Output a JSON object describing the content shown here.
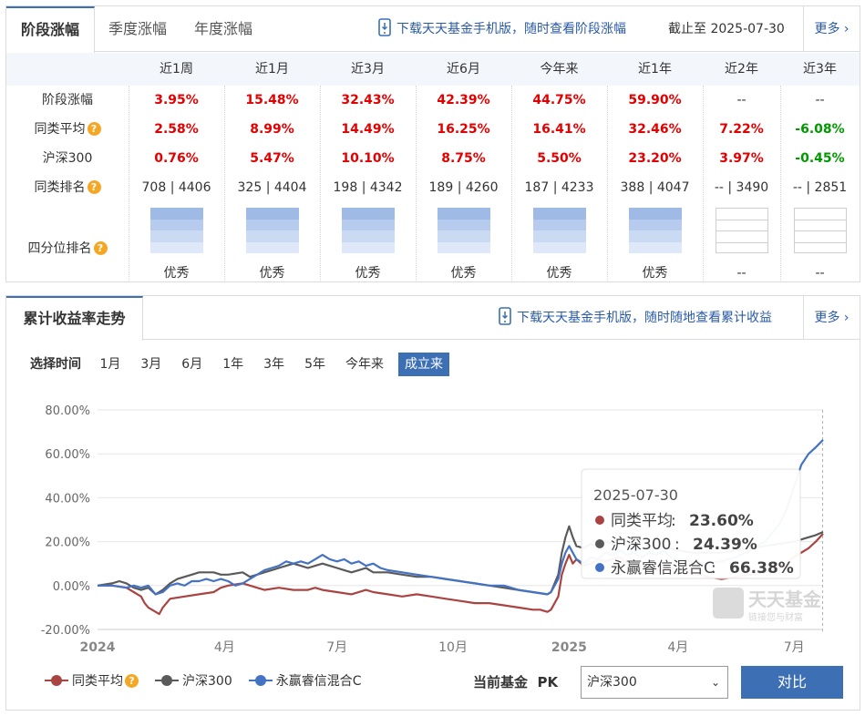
{
  "panel1": {
    "tabs": [
      "阶段涨幅",
      "季度涨幅",
      "年度涨幅"
    ],
    "promo": "下载天天基金手机版，随时查看阶段涨幅",
    "as_of_label": "截止至",
    "as_of_date": "2025-07-30",
    "more": "更多",
    "columns": [
      "近1周",
      "近1月",
      "近3月",
      "近6月",
      "今年来",
      "近1年",
      "近2年",
      "近3年"
    ],
    "rows": [
      {
        "label": "阶段涨幅",
        "has_help": false,
        "values": [
          "3.95%",
          "15.48%",
          "32.43%",
          "42.39%",
          "44.75%",
          "59.90%",
          "--",
          "--"
        ]
      },
      {
        "label": "同类平均",
        "has_help": true,
        "values": [
          "2.58%",
          "8.99%",
          "14.49%",
          "16.25%",
          "16.41%",
          "32.46%",
          "7.22%",
          "-6.08%"
        ]
      },
      {
        "label": "沪深300",
        "has_help": false,
        "values": [
          "0.76%",
          "5.47%",
          "10.10%",
          "8.75%",
          "5.50%",
          "23.20%",
          "3.97%",
          "-0.45%"
        ]
      },
      {
        "label": "同类排名",
        "has_help": true,
        "values": [
          "708 | 4406",
          "325 | 4404",
          "198 | 4342",
          "189 | 4260",
          "187 | 4233",
          "388 | 4047",
          "-- | 3490",
          "-- | 2851"
        ]
      }
    ],
    "quartile_label": "四分位排名",
    "quartile": [
      {
        "level": 4,
        "text": "优秀"
      },
      {
        "level": 4,
        "text": "优秀"
      },
      {
        "level": 4,
        "text": "优秀"
      },
      {
        "level": 4,
        "text": "优秀"
      },
      {
        "level": 4,
        "text": "优秀"
      },
      {
        "level": 4,
        "text": "优秀"
      },
      {
        "level": 0,
        "text": "--"
      },
      {
        "level": 0,
        "text": "--"
      }
    ],
    "colors": {
      "up": "#e30000",
      "down": "#009900",
      "accent": "#3d6fb5"
    }
  },
  "panel2": {
    "title": "累计收益率走势",
    "promo": "下载天天基金手机版，随时随地查看累计收益",
    "more": "更多",
    "range_label": "选择时间",
    "ranges": [
      "1月",
      "3月",
      "6月",
      "1年",
      "3年",
      "5年",
      "今年来",
      "成立来"
    ],
    "active_range": "成立来",
    "pk_label": "当前基金",
    "pk_word": "PK",
    "select_value": "沪深300",
    "compare_button": "对比",
    "tooltip": {
      "date": "2025-07-30",
      "items": [
        {
          "name": "同类平均",
          "value": "23.60%"
        },
        {
          "name": "沪深300",
          "value": "24.39%"
        },
        {
          "name": "永赢睿信混合C",
          "value": "66.38%"
        }
      ]
    },
    "watermark": {
      "main": "天天基金",
      "sub": "链接您与财富"
    }
  },
  "chart_data": {
    "type": "line",
    "ylim": [
      -20,
      80
    ],
    "y_ticks": [
      "80.00%",
      "60.00%",
      "40.00%",
      "20.00%",
      "0.00%",
      "-20.00%"
    ],
    "x_tick_labels": [
      "2024",
      "4月",
      "7月",
      "10月",
      "2025",
      "4月",
      "7月"
    ],
    "x_tick_bold": [
      true,
      false,
      false,
      false,
      true,
      false,
      false
    ],
    "legend": [
      "同类平均",
      "沪深300",
      "永赢睿信混合C"
    ],
    "series": [
      {
        "name": "同类平均",
        "color": "#a94442",
        "points": [
          [
            0,
            0
          ],
          [
            0.02,
            0
          ],
          [
            0.04,
            -1
          ],
          [
            0.05,
            -3
          ],
          [
            0.06,
            -5
          ],
          [
            0.065,
            -8
          ],
          [
            0.07,
            -10
          ],
          [
            0.08,
            -12
          ],
          [
            0.085,
            -13
          ],
          [
            0.09,
            -10
          ],
          [
            0.1,
            -6
          ],
          [
            0.12,
            -5
          ],
          [
            0.14,
            -4
          ],
          [
            0.16,
            -3
          ],
          [
            0.17,
            -1
          ],
          [
            0.18,
            0
          ],
          [
            0.2,
            1
          ],
          [
            0.21,
            0
          ],
          [
            0.22,
            -1
          ],
          [
            0.23,
            -2
          ],
          [
            0.25,
            -1
          ],
          [
            0.27,
            -2
          ],
          [
            0.29,
            -2
          ],
          [
            0.3,
            -1
          ],
          [
            0.31,
            -2
          ],
          [
            0.33,
            -3
          ],
          [
            0.35,
            -4
          ],
          [
            0.37,
            -2
          ],
          [
            0.38,
            -3
          ],
          [
            0.4,
            -4
          ],
          [
            0.42,
            -5
          ],
          [
            0.44,
            -4
          ],
          [
            0.46,
            -5
          ],
          [
            0.48,
            -6
          ],
          [
            0.5,
            -7
          ],
          [
            0.52,
            -8
          ],
          [
            0.54,
            -8
          ],
          [
            0.56,
            -9
          ],
          [
            0.58,
            -10
          ],
          [
            0.6,
            -11
          ],
          [
            0.61,
            -11
          ],
          [
            0.62,
            -12
          ],
          [
            0.625,
            -11
          ],
          [
            0.635,
            -5
          ],
          [
            0.64,
            5
          ],
          [
            0.645,
            10
          ],
          [
            0.65,
            14
          ],
          [
            0.655,
            10
          ],
          [
            0.66,
            12
          ],
          [
            0.67,
            9
          ],
          [
            0.68,
            10
          ],
          [
            0.69,
            12
          ],
          [
            0.7,
            11
          ],
          [
            0.72,
            13
          ],
          [
            0.73,
            10
          ],
          [
            0.74,
            8
          ],
          [
            0.75,
            9
          ],
          [
            0.77,
            7
          ],
          [
            0.79,
            8
          ],
          [
            0.81,
            7
          ],
          [
            0.82,
            5
          ],
          [
            0.83,
            5
          ],
          [
            0.84,
            4
          ],
          [
            0.86,
            3
          ],
          [
            0.88,
            4
          ],
          [
            0.9,
            5
          ],
          [
            0.92,
            6
          ],
          [
            0.94,
            8
          ],
          [
            0.96,
            13
          ],
          [
            0.98,
            17
          ],
          [
            0.99,
            20
          ],
          [
            1.0,
            23.6
          ]
        ]
      },
      {
        "name": "沪深300",
        "color": "#5a5a5a",
        "points": [
          [
            0,
            0
          ],
          [
            0.02,
            1
          ],
          [
            0.03,
            2
          ],
          [
            0.04,
            1
          ],
          [
            0.05,
            -1
          ],
          [
            0.06,
            -2
          ],
          [
            0.07,
            -1
          ],
          [
            0.08,
            -4
          ],
          [
            0.09,
            -2
          ],
          [
            0.1,
            1
          ],
          [
            0.11,
            3
          ],
          [
            0.12,
            4
          ],
          [
            0.13,
            5
          ],
          [
            0.14,
            6
          ],
          [
            0.16,
            6
          ],
          [
            0.17,
            5
          ],
          [
            0.18,
            5
          ],
          [
            0.2,
            6
          ],
          [
            0.21,
            4
          ],
          [
            0.22,
            5
          ],
          [
            0.23,
            6
          ],
          [
            0.24,
            7
          ],
          [
            0.25,
            8
          ],
          [
            0.26,
            9
          ],
          [
            0.27,
            10
          ],
          [
            0.28,
            9
          ],
          [
            0.29,
            8
          ],
          [
            0.3,
            9
          ],
          [
            0.31,
            10
          ],
          [
            0.32,
            9
          ],
          [
            0.33,
            8
          ],
          [
            0.34,
            7
          ],
          [
            0.35,
            6
          ],
          [
            0.36,
            7
          ],
          [
            0.37,
            8
          ],
          [
            0.38,
            6
          ],
          [
            0.4,
            6
          ],
          [
            0.42,
            5
          ],
          [
            0.44,
            4
          ],
          [
            0.46,
            4
          ],
          [
            0.48,
            3
          ],
          [
            0.5,
            2
          ],
          [
            0.52,
            1
          ],
          [
            0.54,
            0
          ],
          [
            0.56,
            -1
          ],
          [
            0.58,
            -2
          ],
          [
            0.6,
            -3
          ],
          [
            0.62,
            -4
          ],
          [
            0.625,
            -3
          ],
          [
            0.635,
            5
          ],
          [
            0.64,
            15
          ],
          [
            0.645,
            22
          ],
          [
            0.65,
            27
          ],
          [
            0.655,
            22
          ],
          [
            0.66,
            18
          ],
          [
            0.67,
            17
          ],
          [
            0.68,
            19
          ],
          [
            0.69,
            18
          ],
          [
            0.7,
            20
          ],
          [
            0.71,
            19
          ],
          [
            0.72,
            21
          ],
          [
            0.73,
            20
          ],
          [
            0.74,
            19
          ],
          [
            0.75,
            20
          ],
          [
            0.76,
            18
          ],
          [
            0.77,
            17
          ],
          [
            0.78,
            18
          ],
          [
            0.79,
            17
          ],
          [
            0.8,
            16
          ],
          [
            0.82,
            15
          ],
          [
            0.84,
            15
          ],
          [
            0.86,
            15
          ],
          [
            0.88,
            16
          ],
          [
            0.9,
            17
          ],
          [
            0.92,
            18
          ],
          [
            0.94,
            19
          ],
          [
            0.96,
            20
          ],
          [
            0.98,
            22
          ],
          [
            0.99,
            23
          ],
          [
            1.0,
            24.39
          ]
        ]
      },
      {
        "name": "永赢睿信混合C",
        "color": "#4472c4",
        "points": [
          [
            0,
            0
          ],
          [
            0.02,
            0
          ],
          [
            0.04,
            -1
          ],
          [
            0.05,
            0
          ],
          [
            0.06,
            -1
          ],
          [
            0.07,
            0
          ],
          [
            0.08,
            -4
          ],
          [
            0.09,
            -3
          ],
          [
            0.1,
            0
          ],
          [
            0.11,
            1
          ],
          [
            0.12,
            0
          ],
          [
            0.13,
            2
          ],
          [
            0.14,
            2
          ],
          [
            0.15,
            3
          ],
          [
            0.16,
            2
          ],
          [
            0.17,
            3
          ],
          [
            0.18,
            2
          ],
          [
            0.19,
            0
          ],
          [
            0.2,
            1
          ],
          [
            0.21,
            3
          ],
          [
            0.22,
            5
          ],
          [
            0.23,
            7
          ],
          [
            0.24,
            8
          ],
          [
            0.25,
            9
          ],
          [
            0.26,
            11
          ],
          [
            0.27,
            10
          ],
          [
            0.28,
            11
          ],
          [
            0.29,
            10
          ],
          [
            0.3,
            12
          ],
          [
            0.31,
            14
          ],
          [
            0.32,
            12
          ],
          [
            0.33,
            11
          ],
          [
            0.34,
            12
          ],
          [
            0.35,
            10
          ],
          [
            0.36,
            11
          ],
          [
            0.37,
            9
          ],
          [
            0.38,
            10
          ],
          [
            0.39,
            8
          ],
          [
            0.4,
            7
          ],
          [
            0.42,
            6
          ],
          [
            0.44,
            5
          ],
          [
            0.46,
            4
          ],
          [
            0.48,
            3
          ],
          [
            0.5,
            2
          ],
          [
            0.52,
            1
          ],
          [
            0.54,
            0
          ],
          [
            0.56,
            0
          ],
          [
            0.58,
            -2
          ],
          [
            0.6,
            -3
          ],
          [
            0.62,
            -4
          ],
          [
            0.625,
            -3
          ],
          [
            0.635,
            3
          ],
          [
            0.64,
            10
          ],
          [
            0.645,
            15
          ],
          [
            0.65,
            18
          ],
          [
            0.655,
            15
          ],
          [
            0.66,
            12
          ],
          [
            0.67,
            10
          ],
          [
            0.68,
            13
          ],
          [
            0.69,
            12
          ],
          [
            0.7,
            15
          ],
          [
            0.71,
            14
          ],
          [
            0.72,
            16
          ],
          [
            0.73,
            14
          ],
          [
            0.74,
            15
          ],
          [
            0.75,
            13
          ],
          [
            0.76,
            15
          ],
          [
            0.77,
            14
          ],
          [
            0.78,
            16
          ],
          [
            0.79,
            13
          ],
          [
            0.8,
            12
          ],
          [
            0.82,
            11
          ],
          [
            0.84,
            10
          ],
          [
            0.86,
            11
          ],
          [
            0.88,
            13
          ],
          [
            0.9,
            16
          ],
          [
            0.92,
            20
          ],
          [
            0.94,
            28
          ],
          [
            0.95,
            35
          ],
          [
            0.96,
            45
          ],
          [
            0.97,
            55
          ],
          [
            0.98,
            60
          ],
          [
            0.99,
            63
          ],
          [
            1.0,
            66.38
          ]
        ]
      }
    ]
  }
}
